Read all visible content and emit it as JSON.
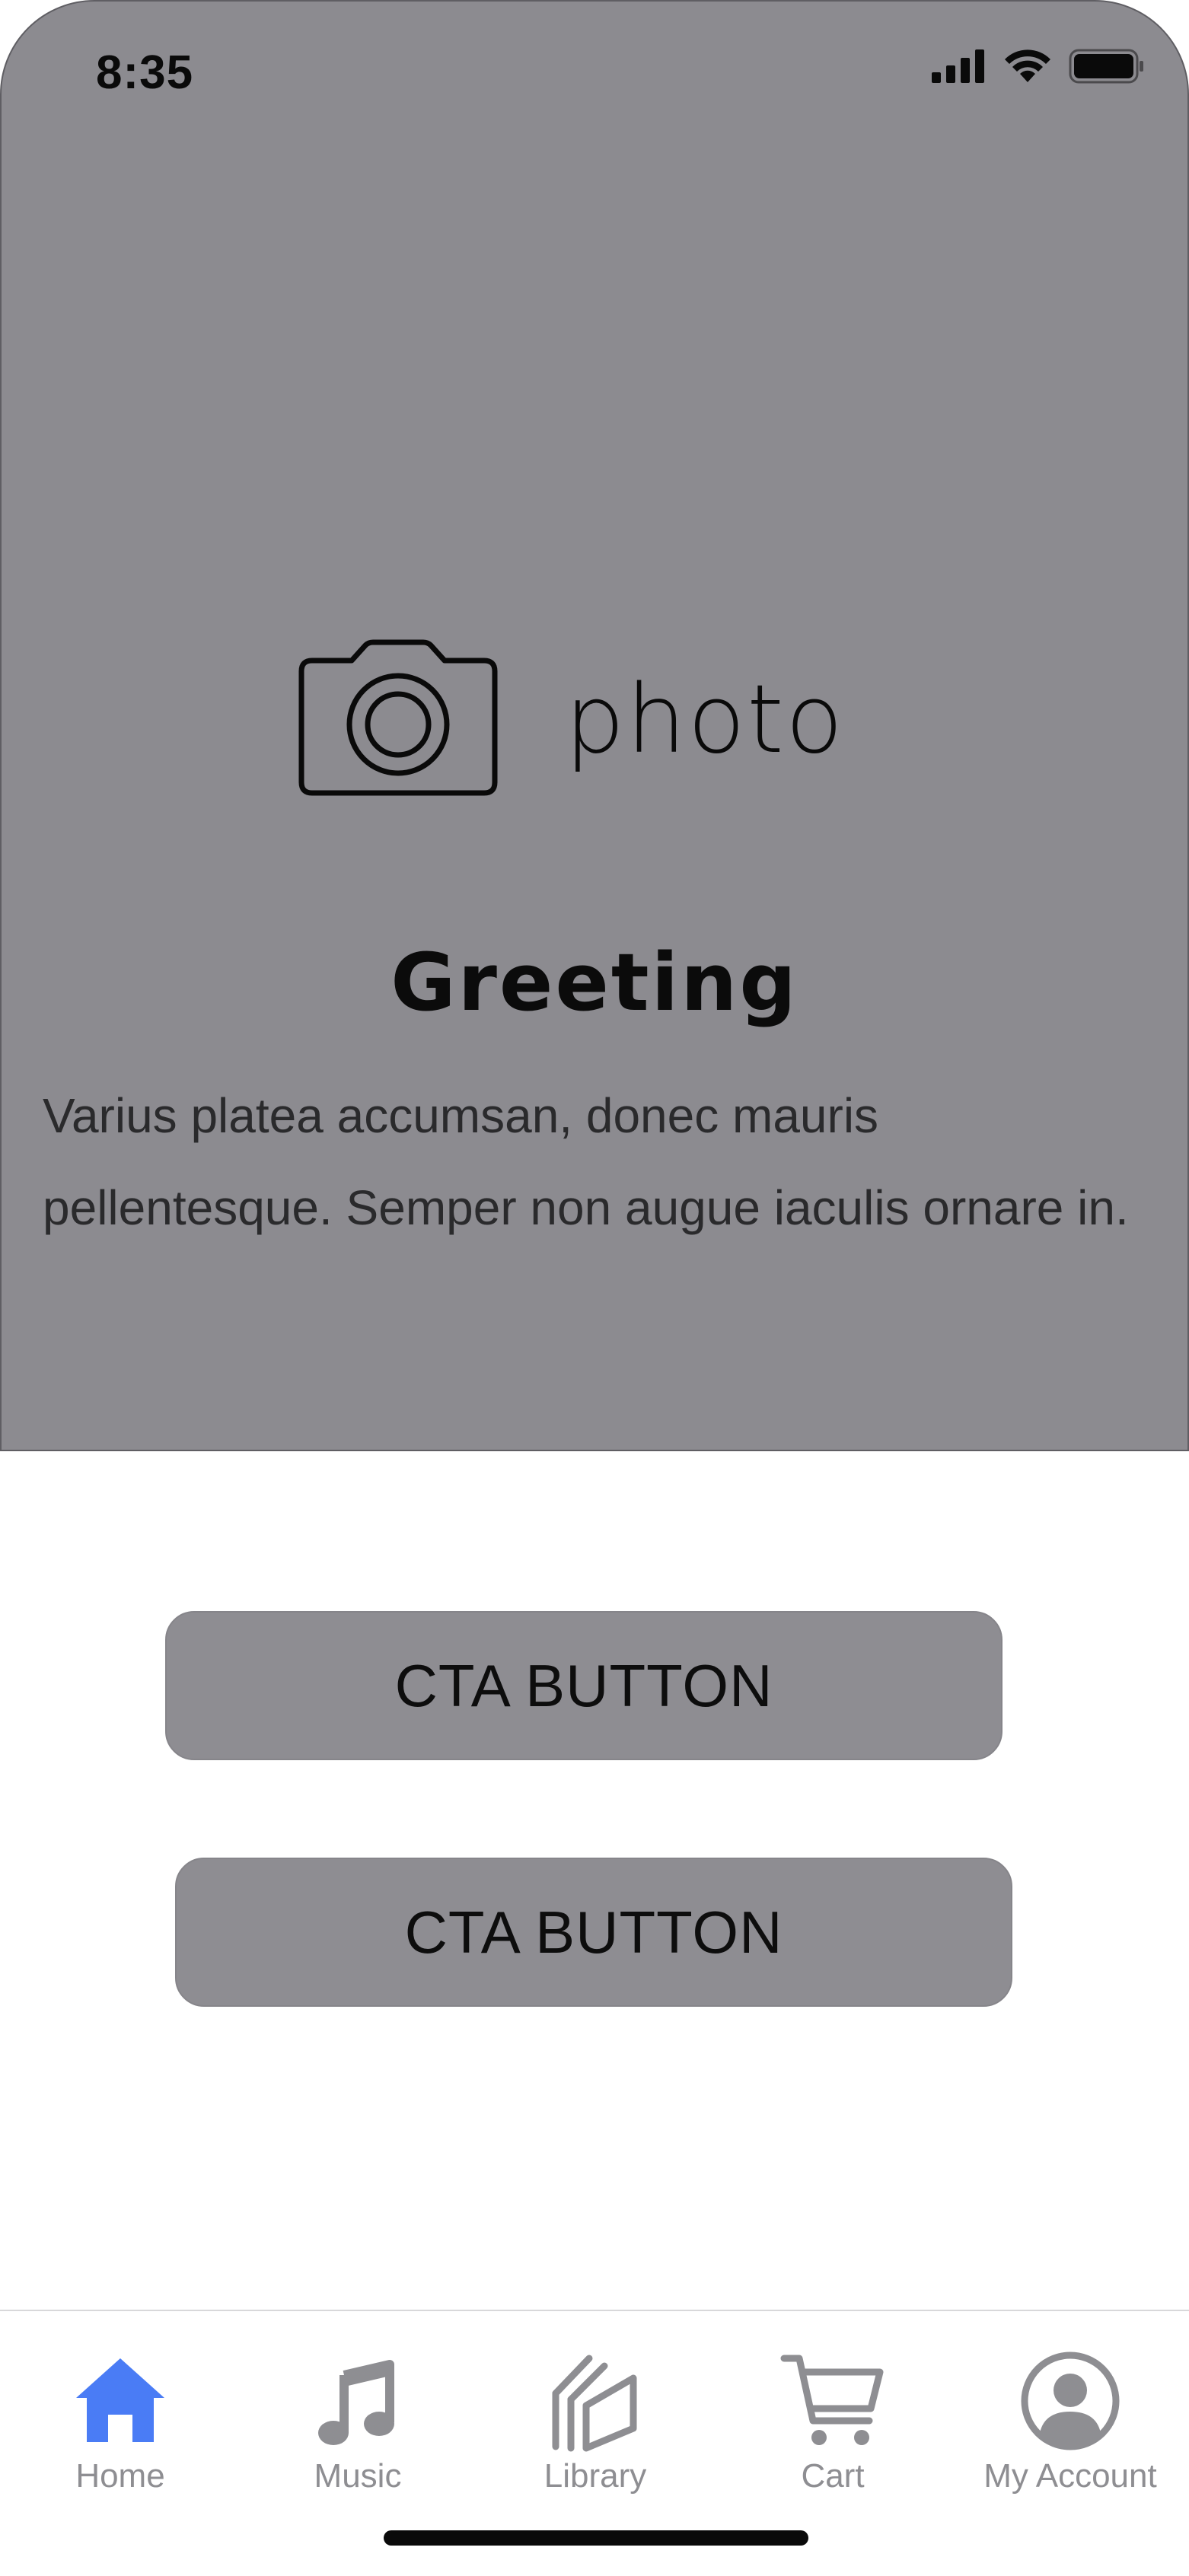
{
  "status_bar": {
    "time": "8:35",
    "icons": [
      "signal-icon",
      "wifi-icon",
      "battery-icon"
    ]
  },
  "hero": {
    "photo_label": "photo",
    "photo_icon": "camera-icon",
    "title": "Greeting",
    "body": "Varius platea accumsan, donec mauris pellentesque. Semper non augue iaculis ornare in.",
    "background": "#8c8b90"
  },
  "buttons": {
    "primary_label": "CTA BUTTON",
    "secondary_label": "CTA BUTTON"
  },
  "tabbar": {
    "active_color": "#4a7cf5",
    "inactive_color": "#8e8e92",
    "items": [
      {
        "label": "Home",
        "icon": "home-icon",
        "active": true
      },
      {
        "label": "Music",
        "icon": "music-note-icon",
        "active": false
      },
      {
        "label": "Library",
        "icon": "library-icon",
        "active": false
      },
      {
        "label": "Cart",
        "icon": "cart-icon",
        "active": false
      },
      {
        "label": "My Account",
        "icon": "account-icon",
        "active": false
      }
    ]
  }
}
